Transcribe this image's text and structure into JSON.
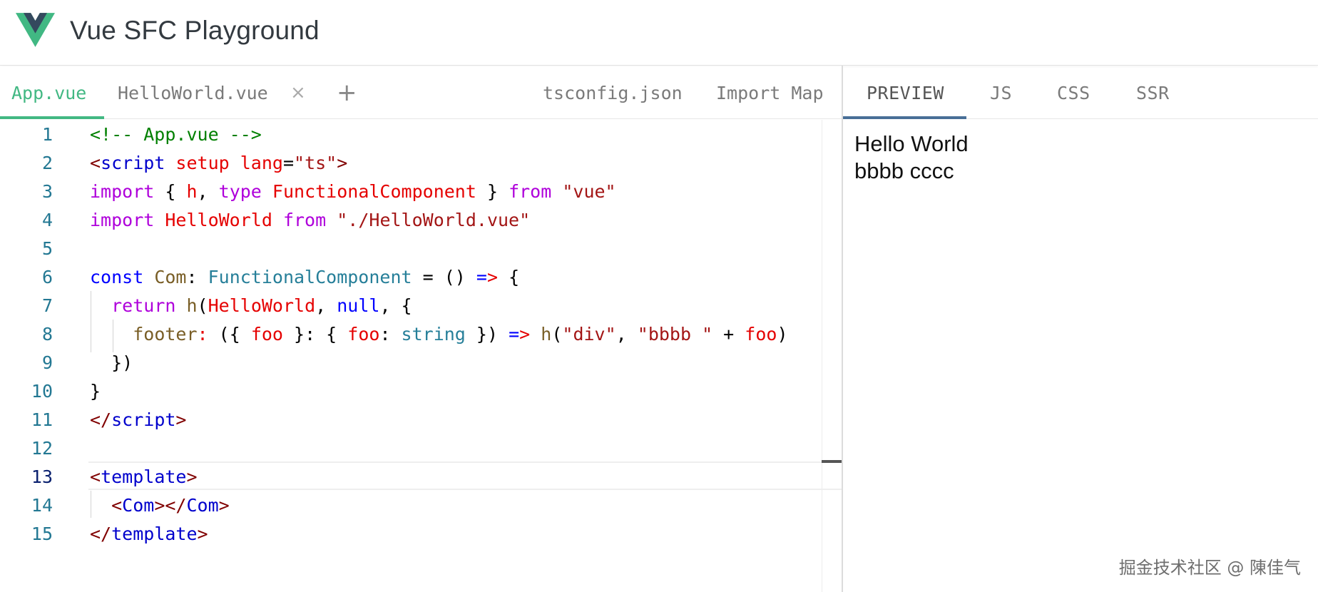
{
  "app": {
    "title": "Vue SFC Playground",
    "logo_icon": "vue-logo-icon",
    "brand_color": "#42b883"
  },
  "editor_tabs": {
    "files": [
      {
        "label": "App.vue",
        "active": true
      },
      {
        "label": "HelloWorld.vue",
        "active": false,
        "close": "×"
      }
    ],
    "add": "+",
    "right": [
      "tsconfig.json",
      "Import Map"
    ]
  },
  "output_tabs": [
    {
      "label": "PREVIEW",
      "active": true
    },
    {
      "label": "JS",
      "active": false
    },
    {
      "label": "CSS",
      "active": false
    },
    {
      "label": "SSR",
      "active": false
    }
  ],
  "code": {
    "current_line": 13,
    "line_numbers": [
      "1",
      "2",
      "3",
      "4",
      "5",
      "6",
      "7",
      "8",
      "9",
      "10",
      "11",
      "12",
      "13",
      "14",
      "15"
    ],
    "lines": [
      [
        [
          "c-comment",
          "<!-- App.vue -->"
        ]
      ],
      [
        [
          "c-tag",
          "<"
        ],
        [
          "c-tagname",
          "script"
        ],
        [
          "",
          "",
          " "
        ],
        [
          "c-attr",
          " setup"
        ],
        [
          "c-attr",
          " lang"
        ],
        [
          "",
          "="
        ],
        [
          "c-str",
          "\"ts\""
        ],
        [
          "c-tag",
          ">"
        ]
      ],
      [
        [
          "c-kw",
          "import"
        ],
        [
          "",
          " { "
        ],
        [
          "c-ident",
          "h"
        ],
        [
          "",
          ", "
        ],
        [
          "c-kw",
          "type"
        ],
        [
          "",
          " "
        ],
        [
          "c-ident",
          "FunctionalComponent"
        ],
        [
          "",
          " } "
        ],
        [
          "c-kw",
          "from"
        ],
        [
          "",
          " "
        ],
        [
          "c-str",
          "\"vue\""
        ]
      ],
      [
        [
          "c-kw",
          "import"
        ],
        [
          "",
          " "
        ],
        [
          "c-ident",
          "HelloWorld"
        ],
        [
          "",
          " "
        ],
        [
          "c-kw",
          "from"
        ],
        [
          "",
          " "
        ],
        [
          "c-str",
          "\"./HelloWorld.vue\""
        ]
      ],
      [],
      [
        [
          "c-decl",
          "const"
        ],
        [
          "",
          " "
        ],
        [
          "c-fn",
          "Com"
        ],
        [
          "",
          ": "
        ],
        [
          "c-type",
          "FunctionalComponent"
        ],
        [
          "",
          " = () "
        ],
        [
          "c-decl",
          "="
        ],
        [
          "c-attr",
          ">"
        ],
        [
          "",
          " {"
        ]
      ],
      [
        [
          "",
          "  "
        ],
        [
          "c-kw",
          "return"
        ],
        [
          "",
          " "
        ],
        [
          "c-fn",
          "h"
        ],
        [
          "",
          "("
        ],
        [
          "c-ident",
          "HelloWorld"
        ],
        [
          "",
          ", "
        ],
        [
          "c-null",
          "null"
        ],
        [
          "",
          ", {"
        ]
      ],
      [
        [
          "",
          "    "
        ],
        [
          "c-prop",
          "footer"
        ],
        [
          "c-attr",
          ":"
        ],
        [
          "",
          " ({ "
        ],
        [
          "c-ident",
          "foo"
        ],
        [
          "",
          " }: { "
        ],
        [
          "c-ident",
          "foo"
        ],
        [
          "",
          ": "
        ],
        [
          "c-type",
          "string"
        ],
        [
          "",
          " }) "
        ],
        [
          "c-decl",
          "="
        ],
        [
          "c-attr",
          ">"
        ],
        [
          "",
          " "
        ],
        [
          "c-fn",
          "h"
        ],
        [
          "",
          "("
        ],
        [
          "c-str",
          "\"div\""
        ],
        [
          "",
          ", "
        ],
        [
          "c-str",
          "\"bbbb \""
        ],
        [
          "",
          " + "
        ],
        [
          "c-ident",
          "foo"
        ],
        [
          "",
          ")"
        ]
      ],
      [
        [
          "",
          "  })"
        ]
      ],
      [
        [
          "",
          "}"
        ]
      ],
      [
        [
          "c-tag",
          "</"
        ],
        [
          "c-tagname",
          "script"
        ],
        [
          "c-tag",
          ">"
        ]
      ],
      [],
      [
        [
          "c-tag",
          "<"
        ],
        [
          "c-tagname",
          "template"
        ],
        [
          "c-tag",
          ">"
        ]
      ],
      [
        [
          "",
          "  "
        ],
        [
          "c-tag",
          "<"
        ],
        [
          "c-tagname",
          "Com"
        ],
        [
          "c-tag",
          "></"
        ],
        [
          "c-tagname",
          "Com"
        ],
        [
          "c-tag",
          ">"
        ]
      ],
      [
        [
          "c-tag",
          "</"
        ],
        [
          "c-tagname",
          "template"
        ],
        [
          "c-tag",
          ">"
        ]
      ]
    ]
  },
  "preview": {
    "line1": "Hello World",
    "line2": "bbbb cccc"
  },
  "watermark": "掘金技术社区 @ 陳佳气"
}
